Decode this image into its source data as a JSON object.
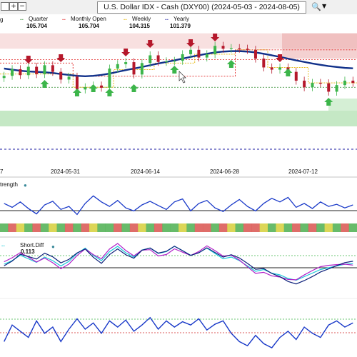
{
  "window": {
    "title": "U.S. Dollar IDX - Cash (DXY00) (2024-05-03 - 2024-08-05)",
    "plus_button": "+",
    "minus_button": "−",
    "search_icon": "magnifier-icon",
    "dropdown_icon": "chevron-down-icon"
  },
  "legend": {
    "quarter_label": "Quarter",
    "quarter_value": "105.704",
    "monthly_label": "Monthly Open",
    "monthly_value": "105.704",
    "weekly_label": "Weekly",
    "weekly_value": "104.315",
    "yearly_label": "Yearly",
    "yearly_value": "101.379",
    "left_edge": "g"
  },
  "x_axis": {
    "left_edge": "7",
    "dates": [
      "2024-05-31",
      "2024-06-14",
      "2024-06-28",
      "2024-07-12"
    ]
  },
  "strength_panel": {
    "label": "trength"
  },
  "diff_panel": {
    "label": "Short.Diff",
    "value": "0.113"
  },
  "colors": {
    "bull": "#3cb54a",
    "bear": "#b5182b",
    "ma": "#10308a",
    "zone_red": "#f2c7c7",
    "zone_green": "#bfe6bf",
    "weekly": "#e6b400",
    "monthly": "#e02020",
    "quarter": "#2e8b2e",
    "yearly": "#1a1aa0"
  },
  "chart_data": [
    {
      "type": "candlestick",
      "title": "U.S. Dollar IDX - Cash (DXY00) (2024-05-03 - 2024-08-05)",
      "x": [
        "05-21",
        "05-22",
        "05-23",
        "05-24",
        "05-27",
        "05-28",
        "05-29",
        "05-30",
        "05-31",
        "06-03",
        "06-04",
        "06-05",
        "06-06",
        "06-07",
        "06-10",
        "06-11",
        "06-12",
        "06-13",
        "06-14",
        "06-17",
        "06-18",
        "06-19",
        "06-20",
        "06-21",
        "06-24",
        "06-25",
        "06-26",
        "06-27",
        "06-28",
        "07-01",
        "07-02",
        "07-03",
        "07-05",
        "07-08",
        "07-09",
        "07-10",
        "07-11",
        "07-12",
        "07-15",
        "07-16",
        "07-17",
        "07-18",
        "07-19",
        "07-22"
      ],
      "close": [
        104.62,
        104.92,
        104.65,
        105.03,
        104.7,
        105.1,
        104.8,
        104.45,
        104.58,
        104.0,
        104.1,
        104.18,
        104.08,
        104.95,
        105.15,
        105.24,
        104.68,
        105.2,
        105.55,
        105.25,
        105.28,
        105.3,
        105.6,
        105.8,
        105.45,
        105.6,
        105.98,
        105.85,
        105.88,
        105.85,
        105.8,
        105.4,
        105.0,
        104.9,
        105.0,
        104.8,
        104.4,
        104.1,
        104.3,
        104.28,
        103.9,
        104.2,
        104.4,
        104.3
      ],
      "series": [
        {
          "name": "Weekly",
          "value": 104.315
        },
        {
          "name": "Monthly Open",
          "value": 105.704
        },
        {
          "name": "Quarter",
          "value": 105.704
        },
        {
          "name": "Yearly",
          "value": 101.379
        }
      ],
      "x_ticks": [
        "2024-05-31",
        "2024-06-14",
        "2024-06-28",
        "2024-07-12"
      ]
    },
    {
      "type": "line",
      "series": [
        {
          "values": [
            0.55,
            0.42,
            0.6,
            0.38,
            0.2,
            0.5,
            0.62,
            0.35,
            0.45,
            0.18,
            0.55,
            0.8,
            0.6,
            0.45,
            0.65,
            0.4,
            0.3,
            0.5,
            0.62,
            0.48,
            0.35,
            0.6,
            0.7,
            0.3,
            0.55,
            0.65,
            0.4,
            0.28,
            0.5,
            0.68,
            0.45,
            0.3,
            0.55,
            0.72,
            0.6,
            0.75,
            0.42,
            0.55,
            0.38,
            0.6,
            0.45,
            0.52,
            0.4,
            0.5
          ]
        }
      ]
    },
    {
      "type": "line",
      "series": [
        {
          "name": "Short.Diff",
          "values": [
            0.1,
            0.2,
            0.35,
            0.25,
            0.15,
            0.3,
            0.2,
            0.05,
            0.18,
            0.4,
            0.55,
            0.35,
            0.2,
            0.45,
            0.6,
            0.42,
            0.3,
            0.5,
            0.55,
            0.4,
            0.45,
            0.6,
            0.48,
            0.35,
            0.42,
            0.55,
            0.4,
            0.25,
            0.3,
            0.2,
            0.05,
            -0.1,
            -0.05,
            -0.15,
            -0.2,
            -0.3,
            -0.35,
            -0.25,
            -0.15,
            -0.05,
            0.0,
            0.05,
            0.1,
            0.113
          ]
        }
      ]
    }
  ]
}
